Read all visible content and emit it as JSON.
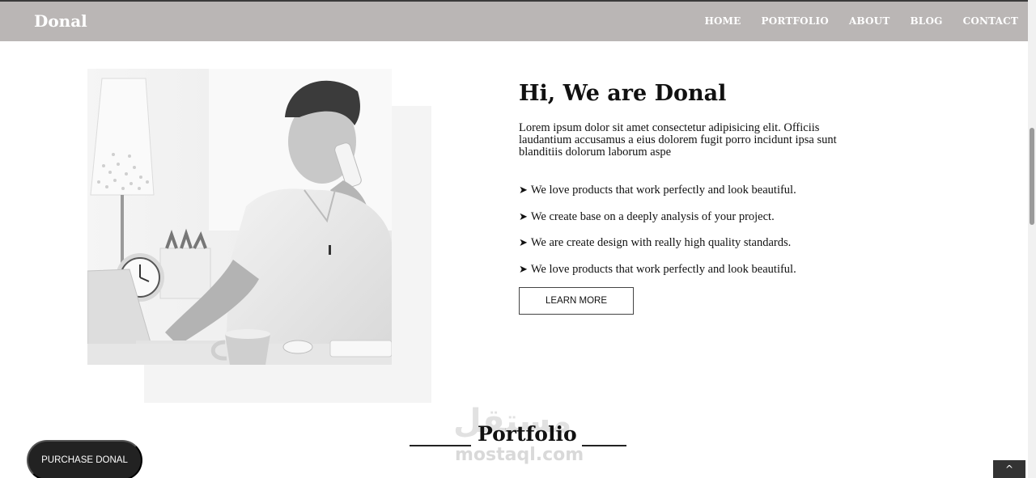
{
  "nav": {
    "brand": "Donal",
    "links": [
      "HOME",
      "PORTFOLIO",
      "ABOUT",
      "BLOG",
      "CONTACT"
    ]
  },
  "about": {
    "heading": "Hi, We are Donal",
    "intro": "Lorem ipsum dolor sit amet consectetur adipisicing elit. Officiis laudantium accusamus a eius dolorem fugit porro incidunt ipsa sunt blanditiis dolorum laborum aspe",
    "features": [
      "We love products that work perfectly and look beautiful.",
      "We create base on a deeply analysis of your project.",
      "We are create design with really high quality standards.",
      "We love products that work perfectly and look beautiful."
    ],
    "button": "LEARN MORE",
    "arrow_glyph": "➤"
  },
  "portfolio": {
    "title": "Portfolio"
  },
  "purchase_button": "PURCHASE DONAL",
  "back_to_top_glyph": "^",
  "watermark": {
    "arabic": "مستقل",
    "latin": "mostaql.com"
  },
  "icons": {
    "arrow": "arrow-right-icon",
    "top": "chevron-up-icon"
  }
}
